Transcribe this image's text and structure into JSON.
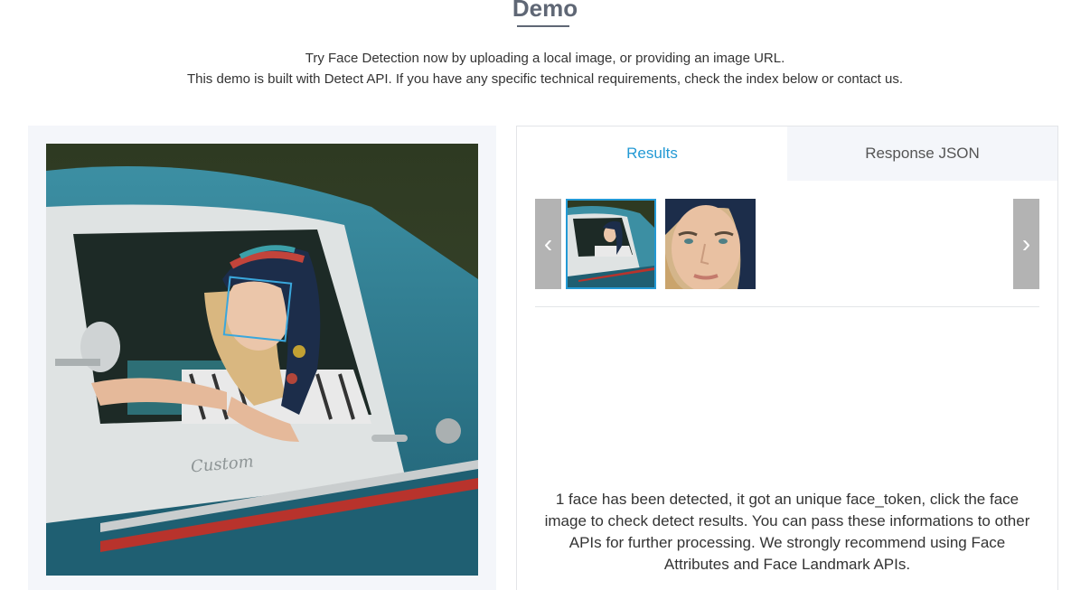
{
  "section": {
    "title": "Demo",
    "description_line1": "Try Face Detection now by uploading a local image, or providing an image URL.",
    "description_line2": "This demo is built with Detect API. If you have any specific technical requirements, check the index below or contact us."
  },
  "results_panel": {
    "tabs": [
      {
        "label": "Results",
        "active": true
      },
      {
        "label": "Response JSON",
        "active": false
      }
    ],
    "prev_arrow": "‹",
    "next_arrow": "›",
    "message": "1 face has been detected, it got an unique face_token, click the face image to check detect results. You can pass these informations to other APIs for further processing. We strongly recommend using Face Attributes and Face Landmark APIs."
  },
  "colors": {
    "accent": "#2399d4",
    "face_box": "#3aa7dc",
    "panel_bg": "#f4f6fa",
    "title": "#5f6775"
  }
}
